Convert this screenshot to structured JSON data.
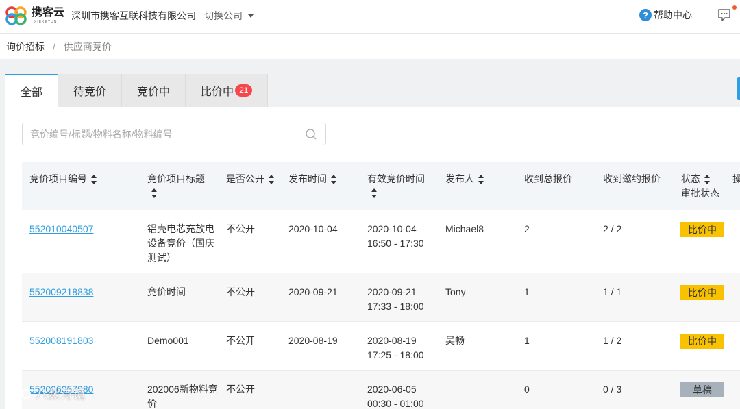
{
  "header": {
    "logo_text": "携客云",
    "logo_sub": "XIEKEYUN",
    "company": "深圳市携客互联科技有限公司",
    "switch_label": "切换公司",
    "help_label": "帮助中心"
  },
  "breadcrumb": {
    "parent": "询价招标",
    "sep": "/",
    "current": "供应商竞价"
  },
  "tabs": [
    {
      "label": "全部",
      "active": true
    },
    {
      "label": "待竞价"
    },
    {
      "label": "竞价中"
    },
    {
      "label": "比价中",
      "badge": "21"
    }
  ],
  "search": {
    "placeholder": "竞价编号/标题/物料名称/物料编号"
  },
  "table": {
    "columns": [
      "竞价项目编号",
      "竞价项目标题",
      "是否公开",
      "发布时间",
      "有效竞价时间",
      "发布人",
      "收到总报价",
      "收到邀约报价",
      "状态",
      "审批状态",
      "操"
    ],
    "rows": [
      {
        "id": "552010040507",
        "title": "铝壳电芯充放电设备竞价（国庆测试）",
        "public": "不公开",
        "published": "2020-10-04",
        "valid_date": "2020-10-04",
        "valid_time": "16:50 - 17:30",
        "publisher": "Michael8",
        "total": "2",
        "invited": "2 / 2",
        "status": "比价中"
      },
      {
        "id": "552009218838",
        "title": "竞价时间",
        "public": "不公开",
        "published": "2020-09-21",
        "valid_date": "2020-09-21",
        "valid_time": "17:33 - 18:00",
        "publisher": "Tony",
        "total": "1",
        "invited": "1 / 1",
        "status": "比价中"
      },
      {
        "id": "552008191803",
        "title": "Demo001",
        "public": "不公开",
        "published": "2020-08-19",
        "valid_date": "2020-08-19",
        "valid_time": "17:25 - 18:00",
        "publisher": "吴畅",
        "total": "1",
        "invited": "1 / 2",
        "status": "比价中"
      },
      {
        "id": "552006057980",
        "title": "202006新物料竞价",
        "public": "不公开",
        "published": "",
        "valid_date": "2020-06-05",
        "valid_time": "00:30 - 01:00",
        "publisher": "",
        "total": "0",
        "invited": "0 / 3",
        "status": "草稿"
      }
    ]
  },
  "watermark": "八数诗镜",
  "colors": {
    "accent": "#2f9ee0",
    "bidding": "#f8c200",
    "draft": "#a7b1bb",
    "badge": "#f5484d"
  }
}
